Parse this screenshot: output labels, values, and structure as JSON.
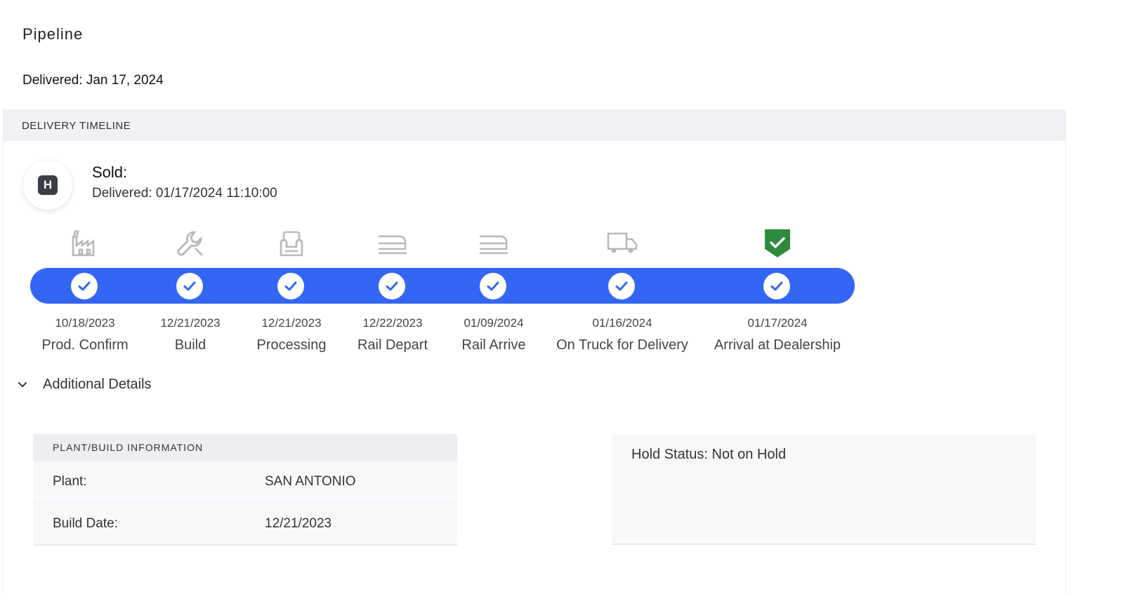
{
  "page": {
    "title": "Pipeline",
    "delivered_summary": "Delivered: Jan 17, 2024"
  },
  "timeline": {
    "header": "DELIVERY TIMELINE",
    "avatar_letter": "H",
    "status_label": "Sold:",
    "status_detail": "Delivered: 01/17/2024 11:10:00",
    "bar_color": "#3366f5",
    "stages": [
      {
        "name": "Prod. Confirm",
        "date": "10/18/2023",
        "icon": "factory-icon",
        "complete": true
      },
      {
        "name": "Build",
        "date": "12/21/2023",
        "icon": "wrench-icon",
        "complete": true
      },
      {
        "name": "Processing",
        "date": "12/21/2023",
        "icon": "car-seat-icon",
        "complete": true
      },
      {
        "name": "Rail Depart",
        "date": "12/22/2023",
        "icon": "train-icon",
        "complete": true
      },
      {
        "name": "Rail Arrive",
        "date": "01/09/2024",
        "icon": "train-icon",
        "complete": true
      },
      {
        "name": "On Truck for Delivery",
        "date": "01/16/2024",
        "icon": "truck-icon",
        "complete": true
      },
      {
        "name": "Arrival at Dealership",
        "date": "01/17/2024",
        "icon": "shield-check-icon",
        "complete": true
      }
    ]
  },
  "details": {
    "toggle_label": "Additional Details",
    "plant_panel": {
      "header": "PLANT/BUILD INFORMATION",
      "rows": [
        {
          "label": "Plant:",
          "value": "SAN ANTONIO"
        },
        {
          "label": "Build Date:",
          "value": "12/21/2023"
        }
      ]
    },
    "hold_status": "Hold Status: Not on Hold"
  },
  "colors": {
    "accent_blue": "#3366f5",
    "success_green": "#2f8a3e",
    "icon_gray": "#b8b8b8"
  }
}
